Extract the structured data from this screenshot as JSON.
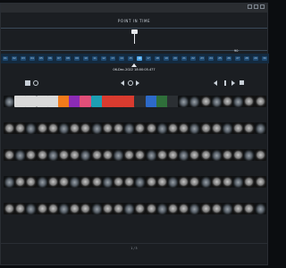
{
  "window": {
    "title": "",
    "chrome": [
      "minimize-icon",
      "maximize-icon",
      "close-icon"
    ]
  },
  "timeline": {
    "title": "POINT IN TIME",
    "right_count": "90",
    "date": "06-Dec-2022 18:00:05.477",
    "ticks": [
      "01",
      "02",
      "03",
      "04",
      "05",
      "06",
      "07",
      "08",
      "09",
      "10",
      "11",
      "12",
      "13",
      "14",
      "15",
      "16",
      "17",
      "18",
      "19",
      "20",
      "21",
      "22",
      "23",
      "24",
      "25",
      "26",
      "27",
      "28",
      "29",
      "30"
    ],
    "active_tick_index": 15
  },
  "toolbar": {
    "left_tools": [
      "grid-icon",
      "list-icon"
    ],
    "center_tools": [
      "prev-icon",
      "stop-icon",
      "next-icon"
    ],
    "right_tools": [
      "back-icon",
      "pause-icon",
      "forward-icon",
      "folder-icon"
    ]
  },
  "gallery": {
    "rows": [
      {
        "type": "files",
        "labels": [
          "",
          "",
          "",
          "",
          "",
          "",
          "",
          "",
          "",
          "",
          "",
          "",
          "",
          "",
          "",
          "",
          "",
          "",
          "",
          "",
          "",
          "",
          "",
          ""
        ]
      },
      {
        "type": "scans",
        "labels": [
          "",
          "",
          "",
          "",
          "",
          "",
          "",
          "",
          "",
          "",
          "",
          "",
          "",
          "",
          "",
          "",
          "",
          "",
          "",
          "",
          "",
          "",
          "",
          ""
        ]
      },
      {
        "type": "scans",
        "labels": [
          "",
          "",
          "",
          "",
          "",
          "",
          "",
          "",
          "",
          "",
          "",
          "",
          "",
          "",
          "",
          "",
          "",
          "",
          "",
          "",
          "",
          "",
          "",
          ""
        ]
      },
      {
        "type": "scans",
        "labels": [
          "",
          "",
          "",
          "",
          "",
          "",
          "",
          "",
          "",
          "",
          "",
          "",
          "",
          "",
          "",
          "",
          "",
          "",
          "",
          "",
          "",
          "",
          "",
          ""
        ]
      },
      {
        "type": "scans",
        "labels": [
          "",
          "",
          "",
          "",
          "",
          "",
          "",
          "",
          "",
          "",
          "",
          "",
          "",
          "",
          "",
          "",
          "",
          "",
          "",
          "",
          "",
          "",
          "",
          ""
        ]
      }
    ]
  },
  "footer": {
    "page": "1 / 3"
  }
}
